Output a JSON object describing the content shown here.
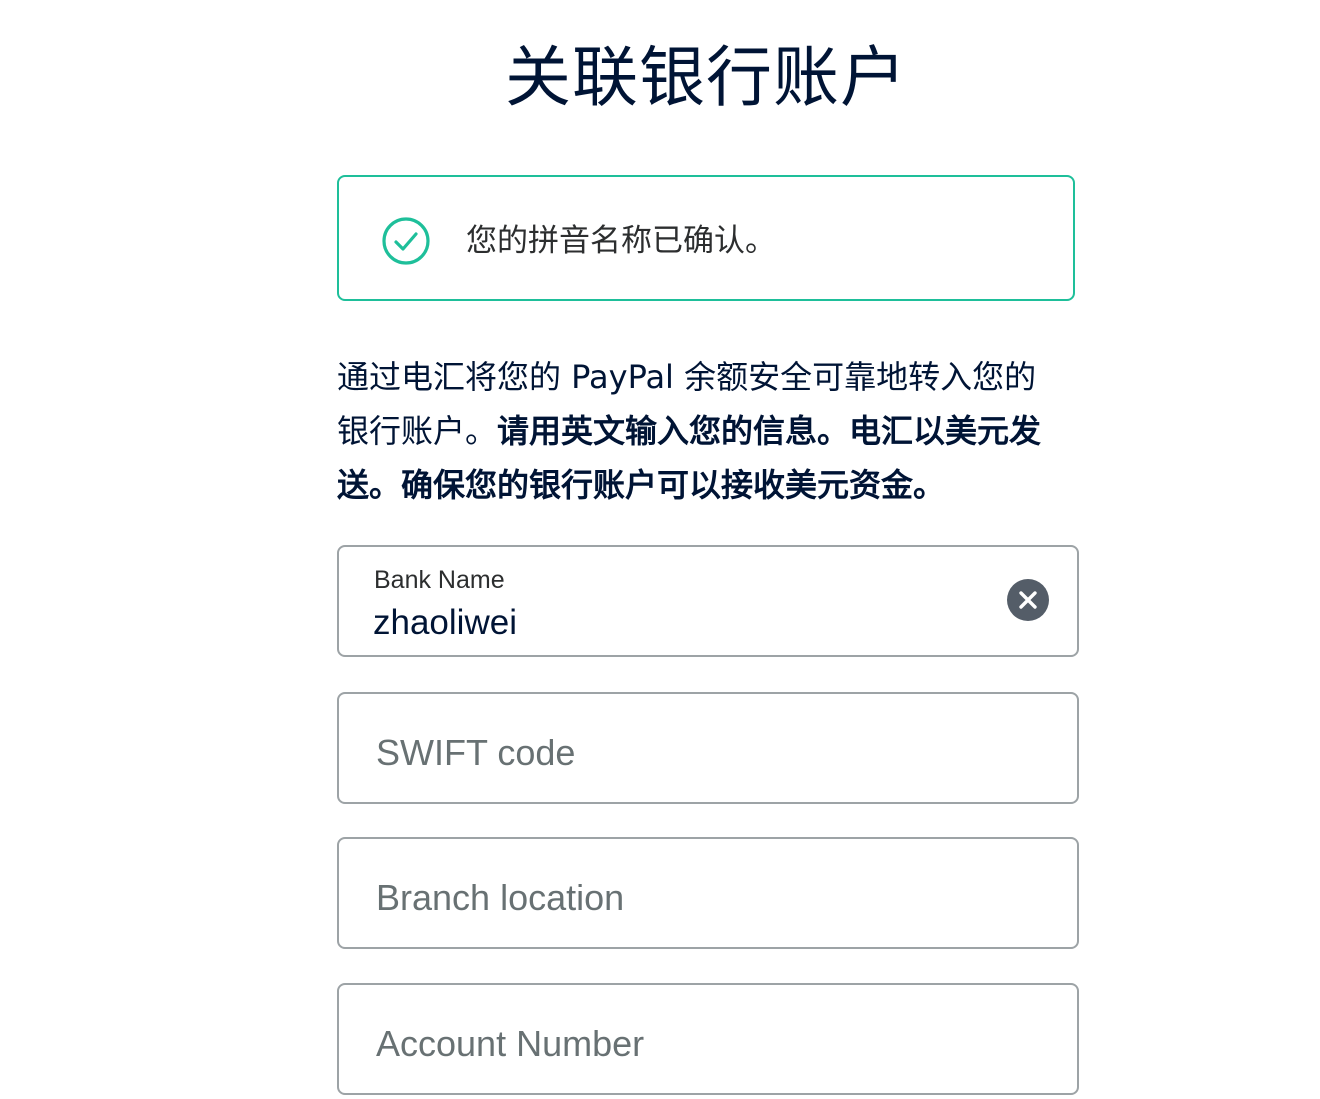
{
  "page": {
    "title": "关联银行账户"
  },
  "confirmation": {
    "icon": "check-circle-icon",
    "text": "您的拼音名称已确认。",
    "color": "#1ebf9a"
  },
  "intro": {
    "line1": "通过电汇将您的 PayPal 余额安全可靠地转入您的",
    "line2_normal": "银行账户。",
    "line2_bold": "请用英文输入您的信息。电汇以美元发",
    "line3_bold": "送。确保您的银行账户可以接收美元资金。"
  },
  "form": {
    "bank_name": {
      "label": "Bank Name",
      "value": "zhaoliwei",
      "clear_icon": "close-icon"
    },
    "swift_code": {
      "placeholder": "SWIFT code"
    },
    "branch_location": {
      "placeholder": "Branch location"
    },
    "account_number": {
      "placeholder": "Account Number"
    }
  }
}
